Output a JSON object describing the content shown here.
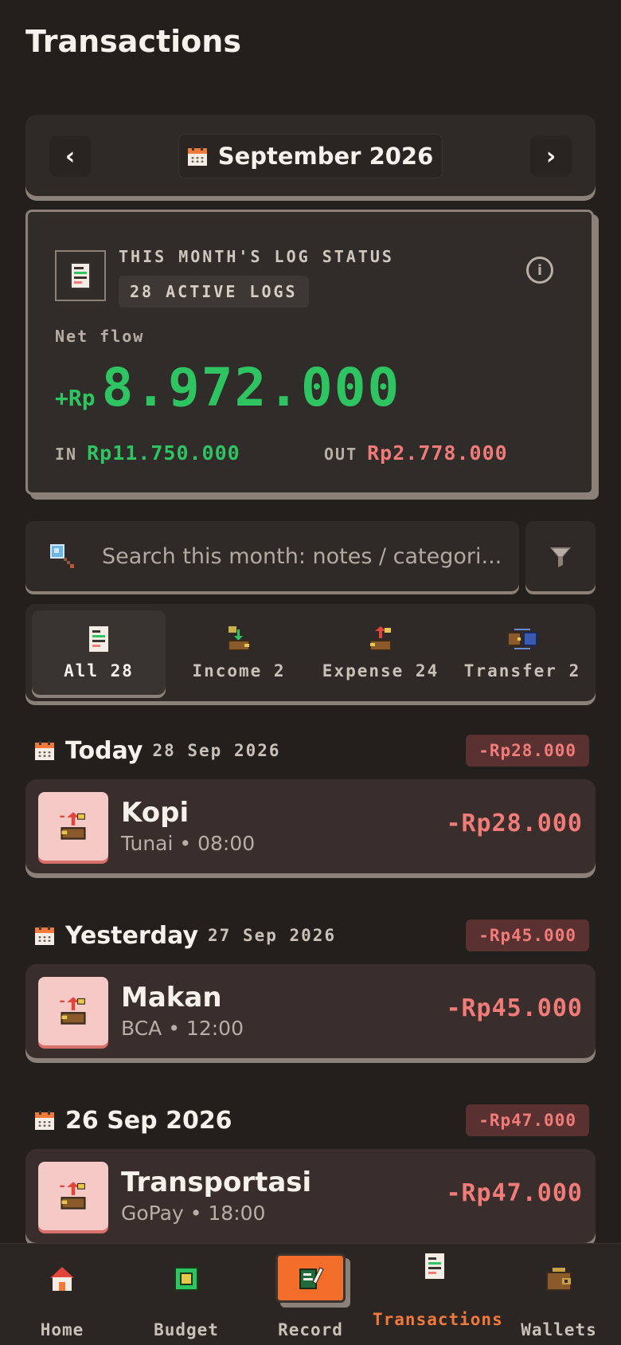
{
  "page": {
    "title": "Transactions"
  },
  "month_selector": {
    "prev_icon": "‹",
    "next_icon": "›",
    "label": "September 2026"
  },
  "status_card": {
    "title": "THIS MONTH'S LOG STATUS",
    "active_logs": "28 ACTIVE LOGS",
    "info_icon": "i",
    "net_flow_label": "Net flow",
    "net_prefix": "+Rp",
    "net_amount": "8.972.000",
    "in_label": "IN",
    "in_value": "Rp11.750.000",
    "out_label": "OUT",
    "out_value": "Rp2.778.000",
    "colors": {
      "positive": "#2fc462",
      "negative": "#f07b78"
    }
  },
  "search": {
    "placeholder": "Search this month: notes / categori..."
  },
  "tabs": [
    {
      "label": "All 28",
      "icon": "receipt-icon",
      "active": true
    },
    {
      "label": "Income 2",
      "icon": "income-icon",
      "active": false
    },
    {
      "label": "Expense 24",
      "icon": "expense-icon",
      "active": false
    },
    {
      "label": "Transfer 2",
      "icon": "transfer-icon",
      "active": false
    }
  ],
  "groups": [
    {
      "day": "Today",
      "date": "28 Sep 2026",
      "total": "-Rp28.000",
      "items": [
        {
          "title": "Kopi",
          "wallet": "Tunai",
          "sep": "•",
          "time": "08:00",
          "amount": "-Rp28.000"
        }
      ]
    },
    {
      "day": "Yesterday",
      "date": "27 Sep 2026",
      "total": "-Rp45.000",
      "items": [
        {
          "title": "Makan",
          "wallet": "BCA",
          "sep": "•",
          "time": "12:00",
          "amount": "-Rp45.000"
        }
      ]
    },
    {
      "day": "26 Sep 2026",
      "date": "",
      "total": "-Rp47.000",
      "items": [
        {
          "title": "Transportasi",
          "wallet": "GoPay",
          "sep": "•",
          "time": "18:00",
          "amount": "-Rp47.000"
        }
      ]
    }
  ],
  "bottom_nav": [
    {
      "label": "Home",
      "icon": "house-icon"
    },
    {
      "label": "Budget",
      "icon": "budget-icon"
    },
    {
      "label": "Record",
      "icon": "record-icon"
    },
    {
      "label": "Transactions",
      "icon": "receipt-icon",
      "active": true
    },
    {
      "label": "Wallets",
      "icon": "wallet-icon"
    }
  ],
  "accent_color": "#f26c2a"
}
